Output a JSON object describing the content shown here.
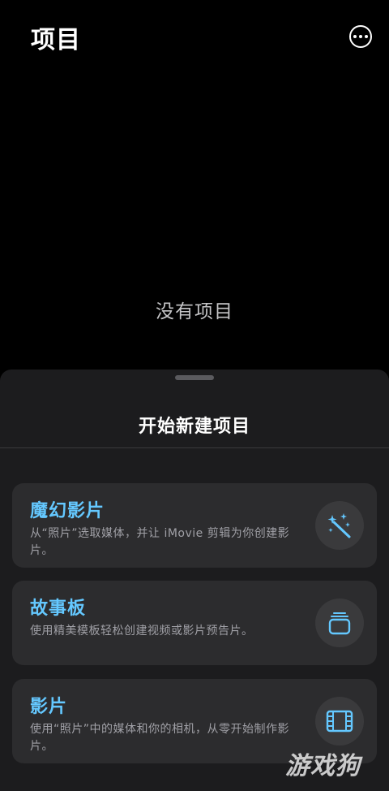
{
  "header": {
    "title": "项目",
    "more_icon": "ellipsis-circle-icon"
  },
  "empty_state": {
    "message": "没有项目"
  },
  "sheet": {
    "title": "开始新建项目",
    "options": [
      {
        "title": "魔幻影片",
        "description": "从“照片”选取媒体，并让 iMovie 剪辑为你创建影片。",
        "icon": "magic-wand-icon"
      },
      {
        "title": "故事板",
        "description": "使用精美模板轻松创建视频或影片预告片。",
        "icon": "storyboard-stack-icon"
      },
      {
        "title": "影片",
        "description": "使用“照片”中的媒体和你的相机，从零开始制作影片。",
        "icon": "film-icon"
      }
    ]
  },
  "watermark": {
    "text": "游戏狗"
  },
  "colors": {
    "background": "#000000",
    "sheet": "#1c1c1e",
    "card": "#2c2c2e",
    "accent": "#64c8ff",
    "secondary_text": "#a0a0a6"
  }
}
